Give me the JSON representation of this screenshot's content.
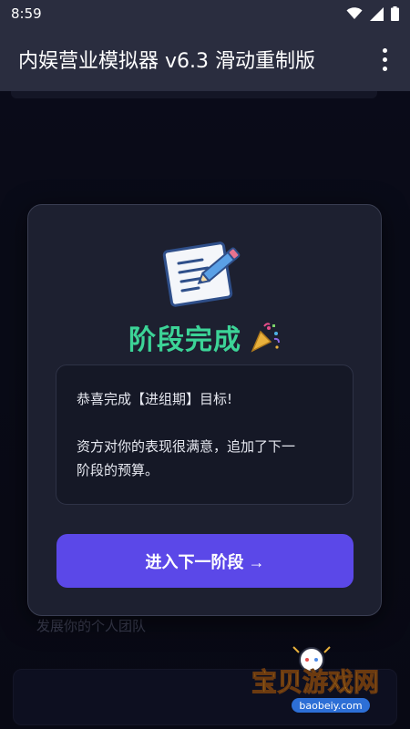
{
  "status_bar": {
    "time": "8:59"
  },
  "app_bar": {
    "title": "内娱营业模拟器 v6.3 滑动重制版"
  },
  "background": {
    "team_label": "发展你的个人团队"
  },
  "modal": {
    "title": "阶段完成",
    "message_line1": "恭喜完成【进组期】目标!",
    "message_line2": "资方对你的表现很满意，追加了下一",
    "message_line3": "阶段的预算。",
    "button_label": "进入下一阶段 →"
  },
  "watermark": {
    "brand": "宝贝游戏网",
    "url": "baobeiy.com"
  },
  "colors": {
    "accent": "#5b48e8",
    "title_green": "#3cd497",
    "surface": "#1d2030"
  }
}
